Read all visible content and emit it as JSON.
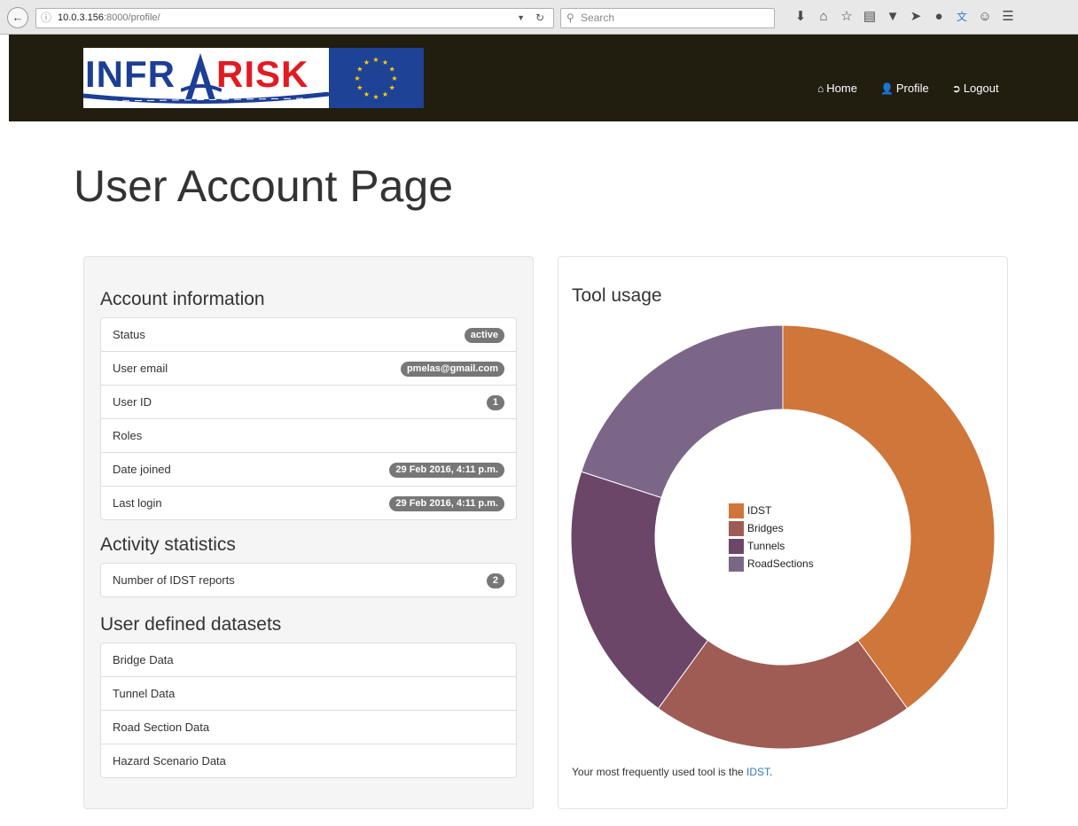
{
  "browser": {
    "url_host": "10.0.3.156",
    "url_path": ":8000/profile/",
    "search_placeholder": "Search"
  },
  "header": {
    "logo_left": "INFR",
    "logo_right": "RISK",
    "nav": [
      {
        "label": "Home",
        "icon": "home-icon"
      },
      {
        "label": "Profile",
        "icon": "user-icon"
      },
      {
        "label": "Logout",
        "icon": "logout-icon"
      }
    ]
  },
  "page": {
    "title": "User Account Page"
  },
  "account": {
    "title": "Account information",
    "rows": [
      {
        "label": "Status",
        "badge": "active"
      },
      {
        "label": "User email",
        "badge": "pmelas@gmail.com"
      },
      {
        "label": "User ID",
        "badge": "1"
      },
      {
        "label": "Roles",
        "badge": ""
      },
      {
        "label": "Date joined",
        "badge": "29 Feb 2016, 4:11 p.m."
      },
      {
        "label": "Last login",
        "badge": "29 Feb 2016, 4:11 p.m."
      }
    ]
  },
  "activity": {
    "title": "Activity statistics",
    "rows": [
      {
        "label": "Number of IDST reports",
        "badge": "2"
      }
    ]
  },
  "datasets": {
    "title": "User defined datasets",
    "rows": [
      "Bridge Data",
      "Tunnel Data",
      "Road Section Data",
      "Hazard Scenario Data"
    ]
  },
  "tool_usage": {
    "title": "Tool usage",
    "footnote_prefix": "Your most frequently used tool is the ",
    "footnote_link": "IDST",
    "footnote_suffix": ".",
    "colors": {
      "IDST": "#cf763b",
      "Bridges": "#9e5c55",
      "Tunnels": "#6b4668",
      "RoadSections": "#7b6688"
    }
  },
  "chart_data": {
    "type": "pie",
    "categories": [
      "IDST",
      "Bridges",
      "Tunnels",
      "RoadSections"
    ],
    "values": [
      40,
      20,
      20,
      20
    ],
    "title": "Tool usage",
    "legend": "center"
  }
}
